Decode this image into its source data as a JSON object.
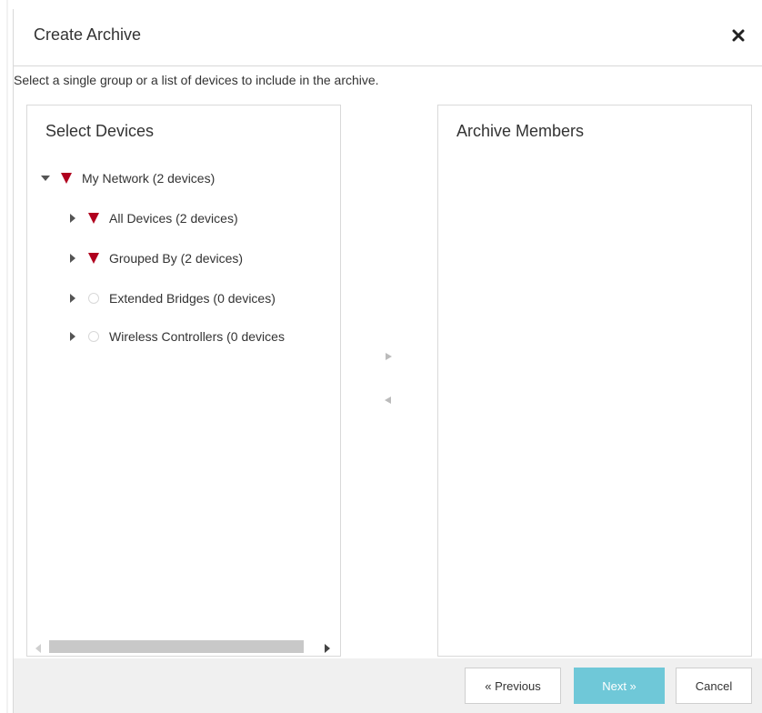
{
  "dialog": {
    "title": "Create Archive",
    "instructions": "Select a single group or a list of devices to include in the archive."
  },
  "select_panel": {
    "title": "Select Devices",
    "tree": [
      {
        "label": "My Network (2 devices)",
        "expanded": true,
        "status": "down-red-triangle"
      },
      {
        "label": "All Devices (2 devices)",
        "expanded": false,
        "status": "down-red-triangle"
      },
      {
        "label": "Grouped By (2 devices)",
        "expanded": false,
        "status": "down-red-triangle"
      },
      {
        "label": "Extended Bridges (0 devices)",
        "expanded": false,
        "status": "empty-circle"
      },
      {
        "label": "Wireless Controllers (0 devices",
        "expanded": false,
        "status": "empty-circle"
      }
    ]
  },
  "members_panel": {
    "title": "Archive Members"
  },
  "transfer": {
    "add_icon": "arrow-right-icon",
    "remove_icon": "arrow-left-icon"
  },
  "footer": {
    "previous_label": "« Previous",
    "next_label": "Next »",
    "cancel_label": "Cancel"
  },
  "colors": {
    "accent": "#6fc8d8",
    "status_down": "#b0001e"
  }
}
